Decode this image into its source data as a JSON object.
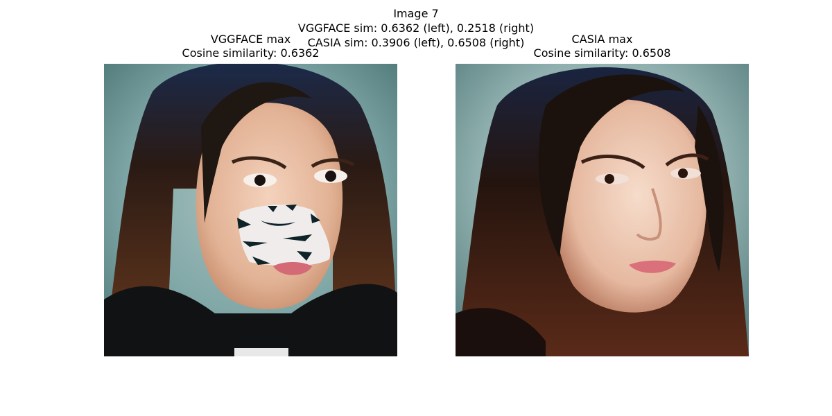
{
  "figure": {
    "suptitle_lines": [
      "Image 7",
      "VGGFACE sim: 0.6362 (left), 0.2518 (right)",
      "CASIA sim: 0.3906 (left), 0.6508 (right)"
    ]
  },
  "panels": [
    {
      "title_line1": "VGGFACE max",
      "title_line2": "Cosine similarity: 0.6362"
    },
    {
      "title_line1": "CASIA max",
      "title_line2": "Cosine similarity: 0.6508"
    }
  ],
  "colors": {
    "background_left": "#7fa6a6",
    "background_right": "#8fb0ae",
    "hair": "#2a1812",
    "skin": "#e6b9a0",
    "patch": "#f1ecec",
    "patch_marks": "#0d2327",
    "lips": "#d46a76"
  }
}
